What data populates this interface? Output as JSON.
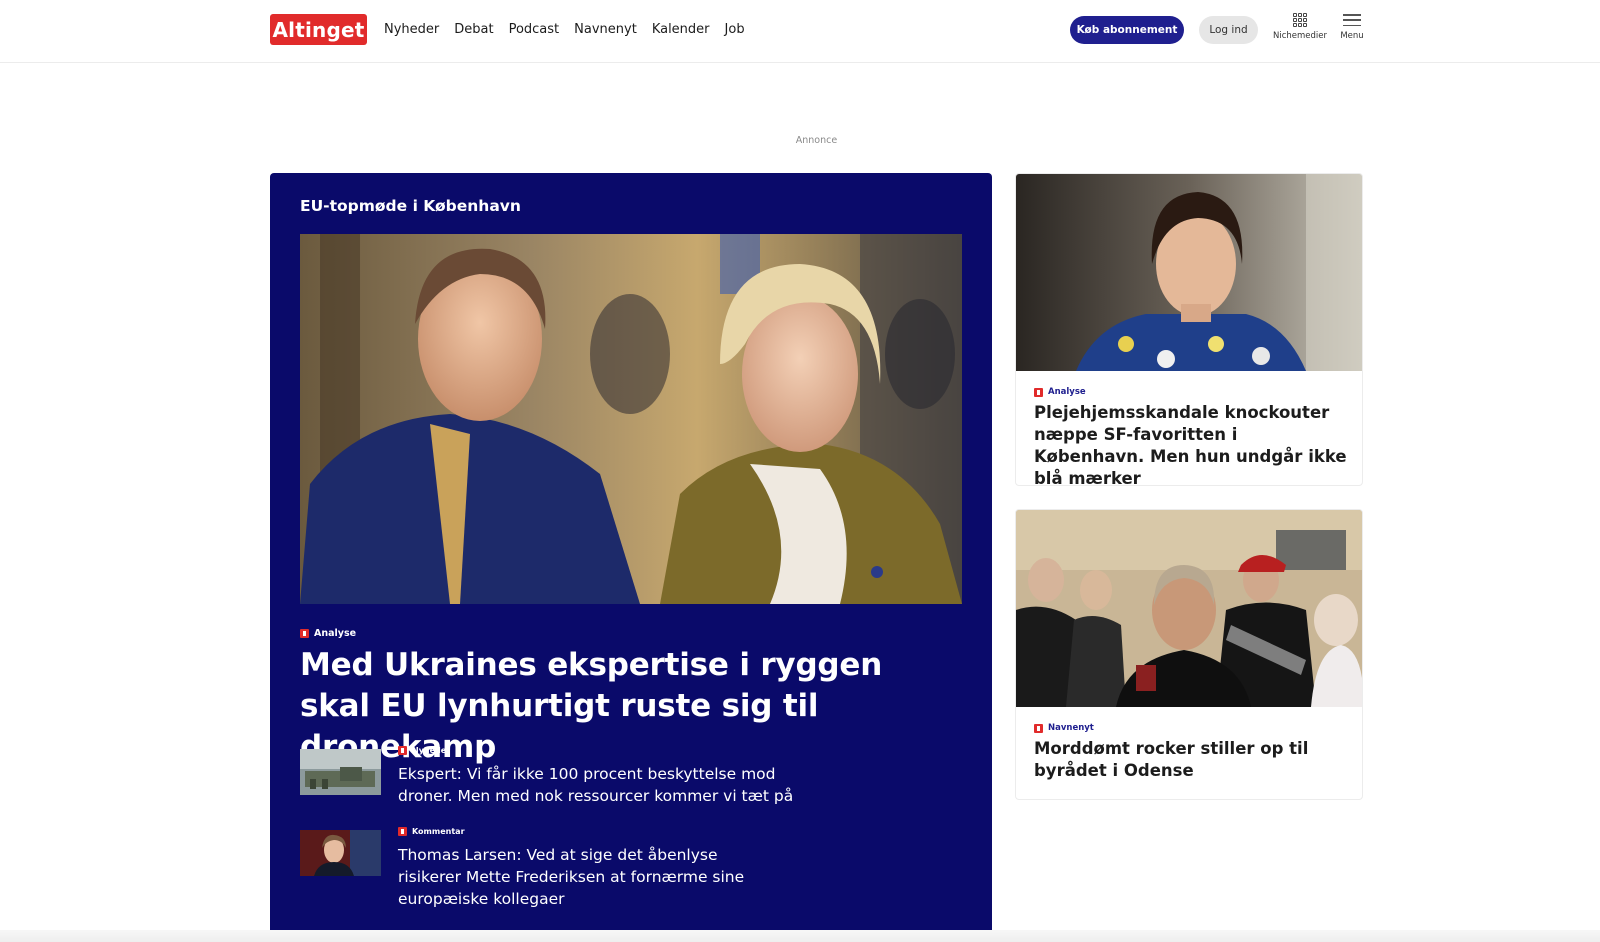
{
  "header": {
    "logo_text": "Altinget",
    "nav": [
      "Nyheder",
      "Debat",
      "Podcast",
      "Navnenyt",
      "Kalender",
      "Job"
    ],
    "subscribe_label": "Køb abonnement",
    "login_label": "Log ind",
    "niche_label": "Nichemedier",
    "menu_label": "Menu"
  },
  "ad": {
    "label": "Annonce"
  },
  "feature": {
    "kicker": "EU-topmøde i København",
    "tag": "Analyse",
    "title": "Med Ukraines ekspertise i ryggen skal EU lynhurtigt ruste sig til dronekamp",
    "sub_items": [
      {
        "tag": "Nyheder",
        "title": "Ekspert: Vi får ikke 100 procent beskyttelse mod droner. Men med nok ressourcer kommer vi tæt på"
      },
      {
        "tag": "Kommentar",
        "title": "Thomas Larsen: Ved at sige det åbenlyse risikerer Mette Frederiksen at fornærme sine europæiske kollegaer"
      }
    ]
  },
  "cards": [
    {
      "tag": "Analyse",
      "title": "Plejehjemsskandale knockouter næppe SF-favoritten i København. Men hun undgår ikke blå mærker"
    },
    {
      "tag": "Navnenyt",
      "title": "Morddømt rocker stiller op til byrådet i Odense"
    }
  ],
  "colors": {
    "brand_red": "#e12b2b",
    "brand_navy": "#0a0a6a",
    "accent_blue": "#1f1f8f"
  }
}
